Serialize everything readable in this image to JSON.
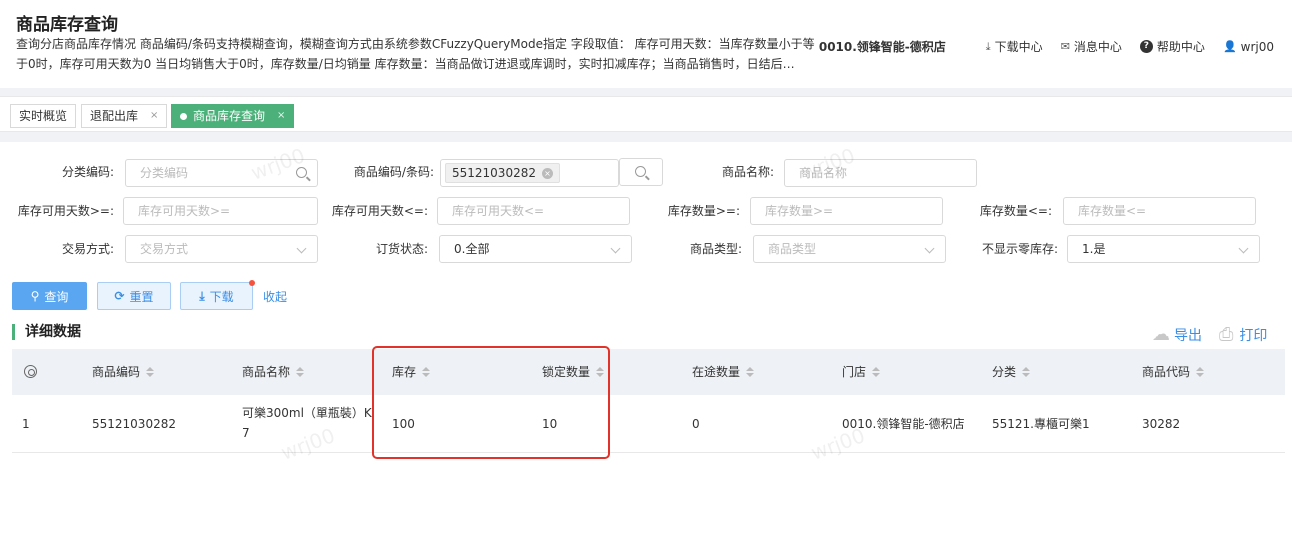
{
  "header": {
    "title": "商品库存查询",
    "description": "查询分店商品库存情况 商品编码/条码支持模糊查询，模糊查询方式由系统参数CFuzzyQueryMode指定 字段取值： 库存可用天数：当库存数量小于等于0时，库存可用天数为0 当日均销售大于0时，库存数量/日均销量 库存数量：当商品做订进退或库调时，实时扣减库存；当商品销售时，日结后…",
    "store": "0010.领锋智能-德积店",
    "download_center": "下载中心",
    "message_center": "消息中心",
    "help_center": "帮助中心",
    "user": "wrj00"
  },
  "tabs": [
    {
      "label": "实时概览"
    },
    {
      "label": "退配出库"
    },
    {
      "label": "商品库存查询"
    }
  ],
  "filters": {
    "category_code": {
      "label": "分类编码:",
      "placeholder": "分类编码"
    },
    "product_code": {
      "label": "商品编码/条码:",
      "chip": "55121030282"
    },
    "product_name": {
      "label": "商品名称:",
      "placeholder": "商品名称"
    },
    "days_min": {
      "label": "库存可用天数>=:",
      "placeholder": "库存可用天数>="
    },
    "days_max": {
      "label": "库存可用天数<=:",
      "placeholder": "库存可用天数<="
    },
    "qty_min": {
      "label": "库存数量>=:",
      "placeholder": "库存数量>="
    },
    "qty_max": {
      "label": "库存数量<=:",
      "placeholder": "库存数量<="
    },
    "trade_mode": {
      "label": "交易方式:",
      "placeholder": "交易方式"
    },
    "order_status": {
      "label": "订货状态:",
      "value": "0.全部"
    },
    "product_type": {
      "label": "商品类型:",
      "placeholder": "商品类型"
    },
    "hide_zero": {
      "label": "不显示零库存:",
      "value": "1.是"
    }
  },
  "actions": {
    "query": "查询",
    "reset": "重置",
    "download": "下载",
    "collapse": "收起"
  },
  "section": {
    "title": "详细数据",
    "export": "导出",
    "print": "打印"
  },
  "table": {
    "columns": [
      "商品编码",
      "商品名称",
      "库存",
      "锁定数量",
      "在途数量",
      "门店",
      "分类",
      "商品代码"
    ],
    "rows": [
      {
        "index": "1",
        "code": "55121030282",
        "name_line1": "可樂300ml（單瓶裝）K",
        "name_line2": "7",
        "stock": "100",
        "locked": "10",
        "in_transit": "0",
        "store": "0010.领锋智能-德积店",
        "category": "55121.專櫃可樂1",
        "product_code": "30282"
      }
    ]
  },
  "watermark": "wrj00"
}
